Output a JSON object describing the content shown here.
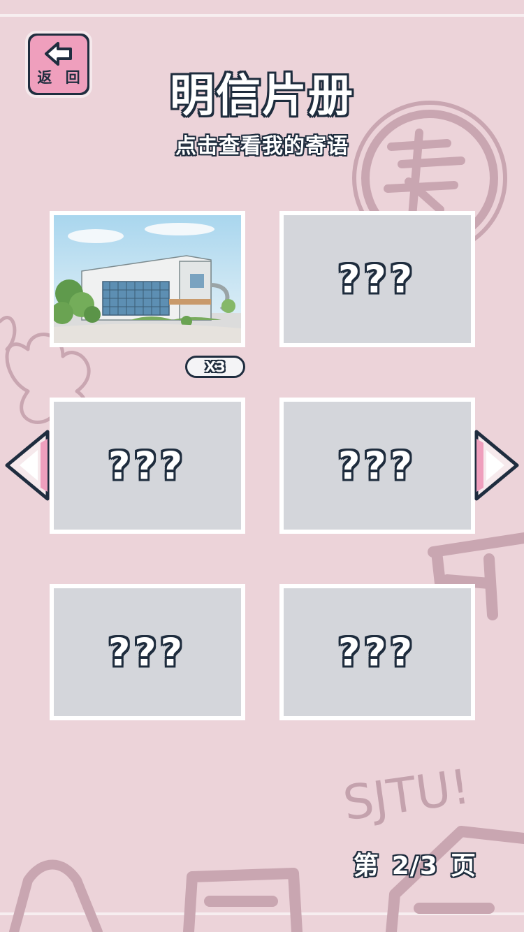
{
  "header": {
    "back_label": "返 回",
    "title": "明信片册",
    "subtitle": "点击查看我的寄语"
  },
  "postcards": [
    {
      "id": "card-1",
      "state": "unlocked",
      "count_label": "X3"
    },
    {
      "id": "card-2",
      "state": "locked",
      "label": "???"
    },
    {
      "id": "card-3",
      "state": "locked",
      "label": "???"
    },
    {
      "id": "card-4",
      "state": "locked",
      "label": "???"
    },
    {
      "id": "card-5",
      "state": "locked",
      "label": "???"
    },
    {
      "id": "card-6",
      "state": "locked",
      "label": "???"
    }
  ],
  "pagination": {
    "prefix": "第",
    "value": "2/3",
    "suffix": "页"
  },
  "background": {
    "doodle_text": "SJTU!"
  },
  "colors": {
    "background": "#ecd3d9",
    "button_pink": "#ef9fbd",
    "outline_navy": "#1f2d3f",
    "locked_card": "#d4d6db"
  }
}
